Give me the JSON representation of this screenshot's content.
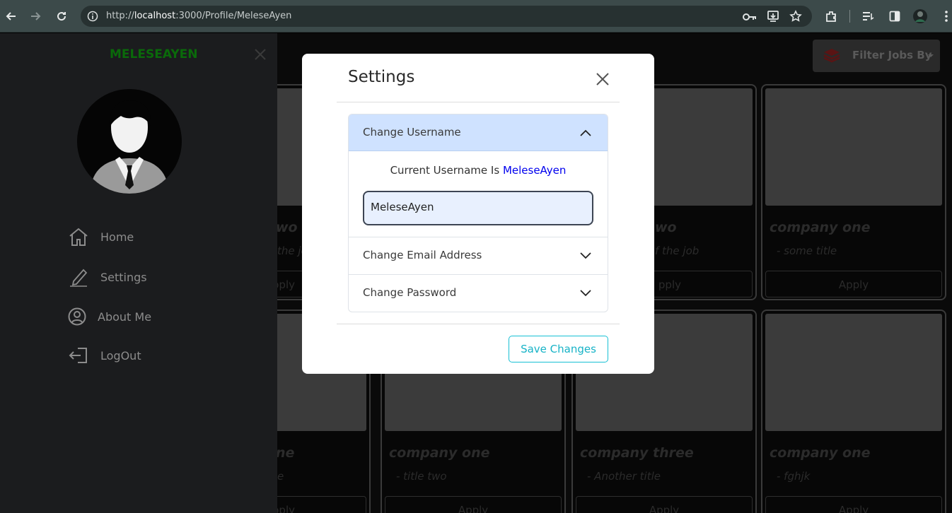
{
  "browser": {
    "url_prefix": "http://",
    "url_host": "localhost",
    "url_rest": ":3000/Profile/MeleseAyen"
  },
  "sidebar": {
    "title": "MELESEAYEN",
    "items": [
      {
        "label": "Home",
        "icon": "home-icon"
      },
      {
        "label": "Settings",
        "icon": "pencil-icon"
      },
      {
        "label": "About Me",
        "icon": "user-circle-icon"
      },
      {
        "label": "LogOut",
        "icon": "logout-icon"
      }
    ]
  },
  "header": {
    "filter_label": "Filter Jobs By"
  },
  "cards": [
    {
      "company": "wo",
      "title": "the jo",
      "apply": "pply"
    },
    {
      "company": "wo",
      "title": "f the job",
      "apply": "pply"
    },
    {
      "company": "company one",
      "title": "- some title",
      "apply": "Apply"
    },
    {
      "company": "ne",
      "title": "e",
      "apply": "pply"
    },
    {
      "company": "company one",
      "title": "- title two",
      "apply": "Apply"
    },
    {
      "company": "company three",
      "title": "- Another title",
      "apply": "Apply"
    },
    {
      "company": "company one",
      "title": "- fghjk",
      "apply": "Apply"
    }
  ],
  "modal": {
    "title": "Settings",
    "sections": {
      "username": {
        "header": "Change Username",
        "current_prefix": "Current Username Is",
        "current_value": "MeleseAyen",
        "input_value": "MeleseAyen"
      },
      "email": {
        "header": "Change Email Address"
      },
      "password": {
        "header": "Change Password"
      }
    },
    "save_label": "Save Changes"
  },
  "colors": {
    "sidebar_title": "#0a6a0a",
    "accordion_active_bg": "#cfe2ff",
    "username_highlight": "#0000ee",
    "save_button": "#17c0d4"
  }
}
